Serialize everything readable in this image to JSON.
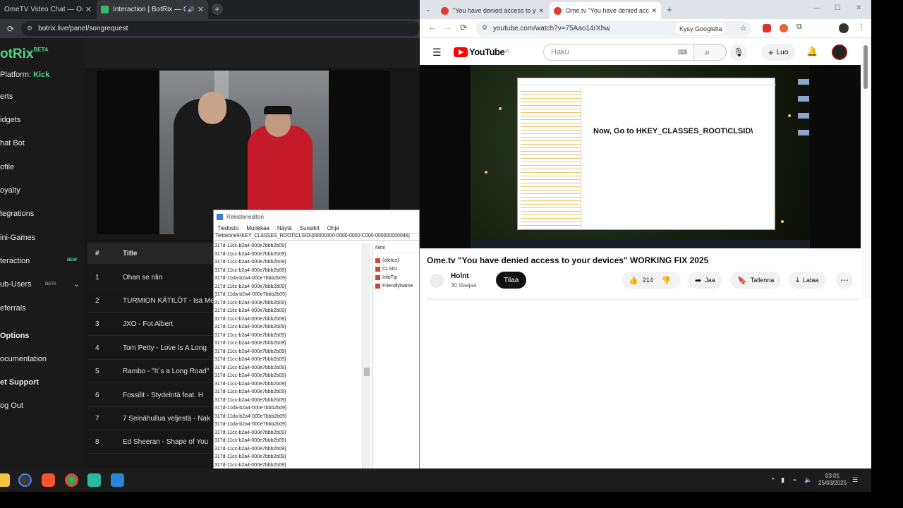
{
  "left_browser": {
    "tabs": [
      {
        "title": "OmeTV Video Chat — Omegle",
        "close": "✕"
      },
      {
        "title": "Interaction | BotRix — Clou",
        "close": "✕",
        "audio": "🔊"
      }
    ],
    "new_tab": "+",
    "url": "botrix.live/panel/songrequest"
  },
  "botrix": {
    "logo": "otRix",
    "beta": "BETA",
    "platform_label": "Platform:",
    "platform_value": "Kick",
    "menu": [
      {
        "label": "erts"
      },
      {
        "label": "idgets"
      },
      {
        "label": "hat Bot"
      },
      {
        "label": "ofile"
      },
      {
        "label": "oyalty"
      },
      {
        "label": "tegrations"
      },
      {
        "label": "ini-Games"
      },
      {
        "label": "teraction",
        "badge": "NEW"
      },
      {
        "label": "ub-Users",
        "badge": "BETA"
      },
      {
        "label": "eferrals"
      }
    ],
    "options_label": "Options",
    "documentation": "ocumentation",
    "support": "et Support",
    "logout": "og Out",
    "table": {
      "headers": [
        "#",
        "Title"
      ],
      "rows": [
        {
          "n": "1",
          "title": "Ohan se nlin"
        },
        {
          "n": "2",
          "title": "TURMION KÄTILÖT - Isä Me"
        },
        {
          "n": "3",
          "title": "JXO - Fot Albert"
        },
        {
          "n": "4",
          "title": "Tom Petty - Love Is A Long"
        },
        {
          "n": "5",
          "title": "Rambo - \"It´s a Long Road\""
        },
        {
          "n": "6",
          "title": "Fossilit - Stydelntä feat. H"
        },
        {
          "n": "7",
          "title": "7 Seinähullua veljestä - Nak"
        },
        {
          "n": "8",
          "title": "Ed Sheeran - Shape of You"
        }
      ]
    }
  },
  "regedit": {
    "title": "Rekisterieditori",
    "menu": [
      "Tiedosto",
      "Muokkaa",
      "Näytä",
      "Suosikit",
      "Ohje"
    ],
    "path": "Tietokone\\HKEY_CLASSES_ROOT\\CLSID\\{00000300-0000-0000-C000-000000000046}",
    "tree_rows": [
      "317d-11cc-b2a4-000e7bbb2b09}",
      "317d-11cc-b2a4-000e7bbb2b09}",
      "317d-11cc-b2a4-000e7bbb2b09}",
      "317d-11cc-b2a4-000e7bbb2b09}",
      "317d-11da-b2a4-000e7bbb2b09}",
      "317d-11cc-b2a4-000e7bbb2b09}",
      "317d-11da-b2a4-000e7bbb2b09}",
      "317d-11cc-b2a4-000e7bbb2b09}",
      "317d-11cc-b2a4-000e7bbb2b09}",
      "317d-11cc-b2a4-000e7bbb2b09}",
      "317d-11cc-b2a4-000e7bbb2b09}",
      "317d-11cc-b2a4-000e7bbb2b09}",
      "317d-11cc-b2a4-000e7bbb2b09}",
      "317d-11cc-b2a4-000e7bbb2b09}",
      "317d-11cc-b2a4-000e7bbb2b09}",
      "317d-11cc-b2a4-000e7bbb2b09}",
      "317d-11cc-b2a4-000e7bbb2b09}",
      "317d-11cc-b2a4-000e7bbb2b09}",
      "317d-11cc-b2a4-000e7bbb2b09}",
      "317d-11cc-b2a4-000e7bbb2b09}",
      "317d-11da-b2a4-000e7bbb2b09}",
      "317d-11da-b2a4-000e7bbb2b09}",
      "317d-11da-b2a4-000e7bbb2b09}",
      "317d-11cc-b2a4-000e7bbb2b09}",
      "317d-11cc-b2a4-000e7bbb2b09}",
      "317d-11cc-b2a4-000e7bbb2b09}",
      "317d-11cc-b2a4-000e7bbb2b09}",
      "317d-11cc-b2a4-000e7bbb2b09}"
    ],
    "values_header": "Nimi",
    "values": [
      "(oletus)",
      "CLSID",
      "InfoTip",
      "FriendlyName"
    ]
  },
  "right_browser": {
    "tabs": [
      {
        "title": "\"You have denied access to you",
        "close": "✕"
      },
      {
        "title": "Ome.tv \"You have denied acc",
        "close": "✕"
      }
    ],
    "new_tab": "+",
    "url": "youtube.com/watch?v=75Aao14rXhw",
    "google_lens": "Kysy Googlelta"
  },
  "youtube": {
    "brand": "YouTube",
    "region": "FI",
    "search_placeholder": "Haku",
    "create_label": "Luo",
    "video_overlay_text": "Now, Go to HKEY_CLASSES_ROOT\\CLSID\\",
    "video_title": "Ome.tv \"You have denied access to your devices\" WORKING FIX 2025",
    "channel_name": "Holnt",
    "subscribers": "30 tilaajaa",
    "subscribe_label": "Tilaa",
    "likes": "214",
    "share_label": "Jaa",
    "save_label": "Tallenna",
    "download_label": "Lataa"
  },
  "taskbar": {
    "time": "03:01",
    "date": "25/03/2025"
  }
}
